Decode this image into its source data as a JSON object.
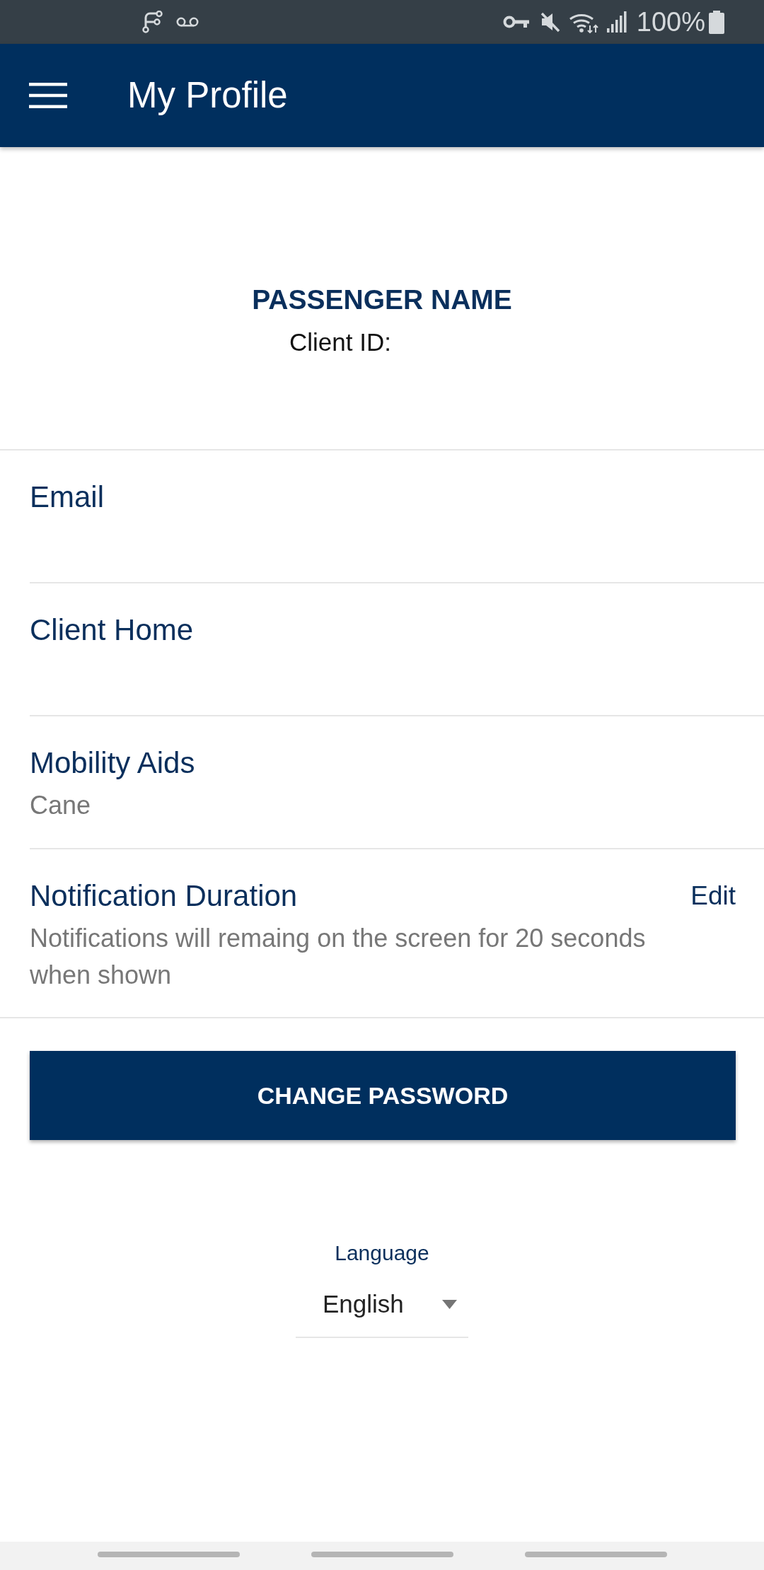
{
  "status_bar": {
    "battery": "100%"
  },
  "app_bar": {
    "title": "My Profile"
  },
  "profile": {
    "name": "PASSENGER NAME",
    "client_id_label": "Client ID:"
  },
  "fields": [
    {
      "kind": "plain",
      "label": "Email"
    },
    {
      "kind": "plain",
      "label": "Client Home"
    },
    {
      "kind": "plain",
      "label": "Mobility Aids",
      "value": "Cane"
    },
    {
      "kind": "editable",
      "label": "Notification Duration",
      "value": "Notifications will remaing on the screen for 20 seconds when shown",
      "action": "Edit"
    }
  ],
  "change_password_button": "CHANGE PASSWORD",
  "language": {
    "label": "Language",
    "value": "English"
  }
}
